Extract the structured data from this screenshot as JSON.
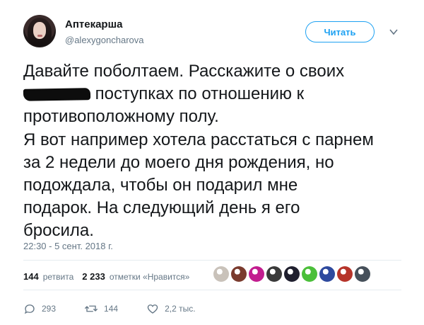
{
  "user": {
    "display_name": "Аптекарша",
    "handle": "@alexygoncharova",
    "avatar_icon": "avatar-photo"
  },
  "follow_button": {
    "label": "Читать"
  },
  "menu": {
    "icon": "chevron-down-icon"
  },
  "tweet": {
    "line1": "Давайте поболтаем. Расскажите о своих",
    "line2_after_redaction": " поступках по отношению к",
    "line3": "противоположному полу.",
    "line4": "Я вот например хотела расстаться с парнем",
    "line5": "за 2 недели до моего дня рождения, но",
    "line6": "подождала, чтобы он подарил мне",
    "line7": "подарок. На следующий день я его",
    "line8": "бросила."
  },
  "timestamp": "22:30 - 5 сент. 2018 г.",
  "stats": {
    "retweets_count": "144",
    "retweets_label": "ретвита",
    "likes_count": "2 233",
    "likes_label": "отметки «Нравится»"
  },
  "likers": [
    {
      "color": "#c9c2ba"
    },
    {
      "color": "#7a3b2e"
    },
    {
      "color": "#c21d8f"
    },
    {
      "color": "#3a3a3a"
    },
    {
      "color": "#1f1f2e"
    },
    {
      "color": "#4bbf3a"
    },
    {
      "color": "#2e4a9e"
    },
    {
      "color": "#b6342a"
    },
    {
      "color": "#46505a"
    }
  ],
  "actions": {
    "reply_count": "293",
    "retweet_count": "144",
    "like_count": "2,2 тыс."
  },
  "colors": {
    "accent": "#1da1f2",
    "text": "#14171a",
    "muted": "#657786",
    "divider": "#e6ecf0"
  }
}
